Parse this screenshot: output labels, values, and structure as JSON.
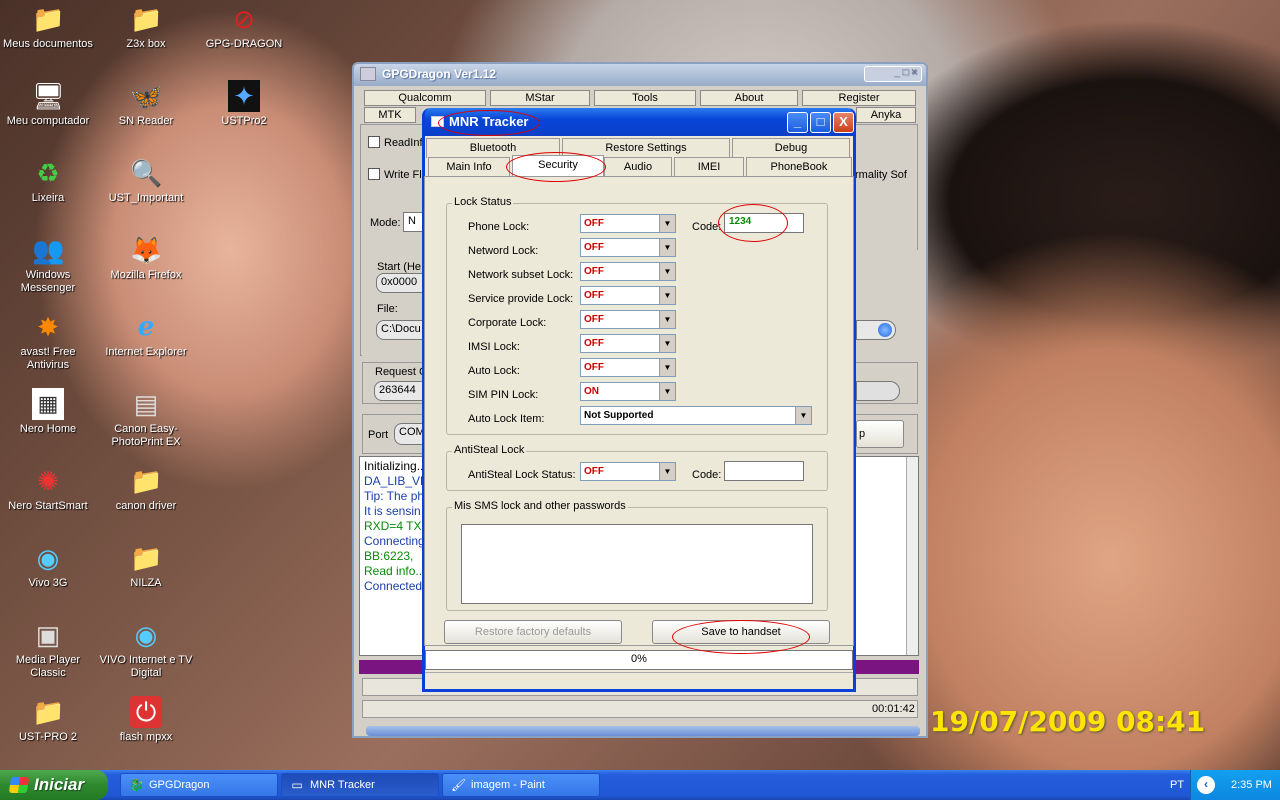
{
  "desktop": {
    "icons": [
      {
        "label": "Meus documentos",
        "glyph": "📁"
      },
      {
        "label": "Z3x box",
        "glyph": "📁"
      },
      {
        "label": "GPG-DRAGON",
        "glyph": "⊘"
      },
      {
        "label": "Meu computador",
        "glyph": "🖥"
      },
      {
        "label": "SN Reader",
        "glyph": "🦋"
      },
      {
        "label": "USTPro2",
        "glyph": "✦"
      },
      {
        "label": "Lixeira",
        "glyph": "♻"
      },
      {
        "label": "UST_Important",
        "glyph": "🔍"
      },
      {
        "label": "Windows Messenger",
        "glyph": "👥"
      },
      {
        "label": "Mozilla Firefox",
        "glyph": "🦊"
      },
      {
        "label": "avast! Free Antivirus",
        "glyph": "✸"
      },
      {
        "label": "Internet Explorer",
        "glyph": "e"
      },
      {
        "label": "Nero Home",
        "glyph": "▦"
      },
      {
        "label": "Canon Easy-PhotoPrint EX",
        "glyph": "▤"
      },
      {
        "label": "Nero StartSmart",
        "glyph": "✺"
      },
      {
        "label": "canon driver",
        "glyph": "📁"
      },
      {
        "label": "Vivo 3G",
        "glyph": "◉"
      },
      {
        "label": "NILZA",
        "glyph": "📁"
      },
      {
        "label": "Media Player Classic",
        "glyph": "▣"
      },
      {
        "label": "VIVO Internet e TV Digital",
        "glyph": "◉"
      },
      {
        "label": "UST-PRO 2",
        "glyph": "📁"
      },
      {
        "label": "flash mpxx",
        "glyph": "⏻"
      }
    ],
    "date_stamp": "19/07/2009 08:41"
  },
  "gpg": {
    "title": "GPGDragon Ver1.12",
    "menu_row1": [
      "Qualcomm",
      "MStar",
      "Tools",
      "About",
      "Register"
    ],
    "menu_row2": [
      "MTK",
      "Anyka"
    ],
    "readinfo": "ReadInf",
    "writefla": "Write Fla",
    "mode": "Mode:",
    "mode_value": "N",
    "start": "Start (He",
    "start_value": "0x0000",
    "file": "File:",
    "file_value": "C:\\Docu",
    "request": "Request C",
    "request_value": "263644",
    "port": "Port",
    "port_value": "COM",
    "normality": "rmality Sof",
    "stop": "p",
    "timer": "00:01:42",
    "log": [
      "Initializing...",
      "DA_LIB_VE",
      "Tip: The ph",
      "It is sensin",
      "RXD=4  TX",
      "Connecting",
      "BB:6223,",
      "Read info...",
      "Connected"
    ]
  },
  "mnr": {
    "title": "MNR Tracker",
    "buttons": {
      "minimize": "_",
      "maximize": "□",
      "close": "X"
    },
    "tabs_row1": [
      "Bluetooth",
      "Restore Settings",
      "Debug"
    ],
    "tabs_row2": [
      "Main Info",
      "Security",
      "Audio",
      "IMEI",
      "PhoneBook"
    ],
    "lock_status": {
      "group": "Lock Status",
      "rows": [
        {
          "label": "Phone Lock:",
          "value": "OFF"
        },
        {
          "label": "Netword Lock:",
          "value": "OFF"
        },
        {
          "label": "Network subset Lock:",
          "value": "OFF"
        },
        {
          "label": "Service provide Lock:",
          "value": "OFF"
        },
        {
          "label": "Corporate Lock:",
          "value": "OFF"
        },
        {
          "label": "IMSI Lock:",
          "value": "OFF"
        },
        {
          "label": "Auto Lock:",
          "value": "OFF"
        },
        {
          "label": "SIM PIN Lock:",
          "value": "ON"
        }
      ],
      "auto_lock_item_label": "Auto Lock Item:",
      "auto_lock_item_value": "Not Supported",
      "code_label": "Code:",
      "code_value": "1234"
    },
    "antisteal": {
      "group": "AntiSteal Lock",
      "label": "AntiSteal Lock Status:",
      "value": "OFF",
      "code_label": "Code:",
      "code_value": ""
    },
    "sms": {
      "group": "Mis SMS lock and other passwords"
    },
    "restore_btn": "Restore factory defaults",
    "save_btn": "Save to handset",
    "progress": "0%"
  },
  "taskbar": {
    "start": "Iniciar",
    "items": [
      {
        "label": "GPGDragon",
        "glyph": "🐉"
      },
      {
        "label": "MNR Tracker",
        "glyph": "▭"
      },
      {
        "label": "imagem - Paint",
        "glyph": "🖌"
      }
    ],
    "lang": "PT",
    "time": "2:35 PM"
  }
}
